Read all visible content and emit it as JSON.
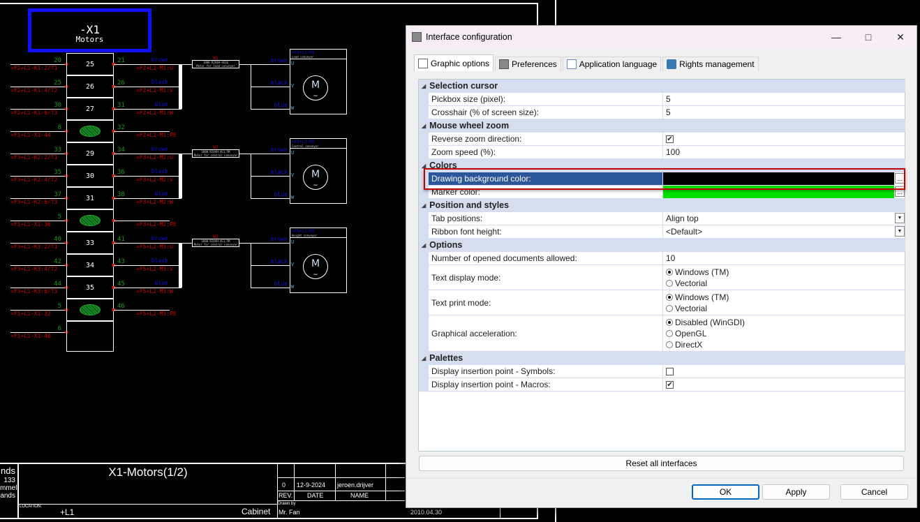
{
  "drawing": {
    "background_color": "#000000",
    "strip_title": "-X1",
    "strip_subtitle": "Motors",
    "rows": [
      {
        "left_num": "20",
        "left_ref": "=F2+L1-K1:2/T1",
        "terminal": "25",
        "right_num": "21",
        "wire": "brown",
        "right_ref": "=F2+L2-M1:U"
      },
      {
        "left_num": "25",
        "left_ref": "=F2+L1-K1:4/T2",
        "terminal": "26",
        "right_num": "26",
        "wire": "black",
        "right_ref": "=F2+L2-M1:V"
      },
      {
        "left_num": "30",
        "left_ref": "=F2+L1-K1:6/T3",
        "terminal": "27",
        "right_num": "31",
        "wire": "blue",
        "right_ref": "=F2+L2-M1:W"
      },
      {
        "left_num": "8",
        "left_ref": "=F1+L1-X1-44",
        "terminal": "PE",
        "right_num": "32",
        "wire": "",
        "right_ref": "=F2+L2-M1:PE"
      },
      {
        "left_num": "33",
        "left_ref": "=F3+L1-K2:2/T1",
        "terminal": "29",
        "right_num": "34",
        "wire": "brown",
        "right_ref": "=F3+L2-M2:U"
      },
      {
        "left_num": "35",
        "left_ref": "=F3+L1-K2:4/T2",
        "terminal": "30",
        "right_num": "36",
        "wire": "black",
        "right_ref": "=F3+L2-M2:V"
      },
      {
        "left_num": "37",
        "left_ref": "=F3+L1-K2:6/T3",
        "terminal": "31",
        "right_num": "38",
        "wire": "blue",
        "right_ref": "=F3+L2-M2:W"
      },
      {
        "left_num": "5",
        "left_ref": "=F1+L1-X1-36",
        "terminal": "PE",
        "right_num": "",
        "wire": "",
        "right_ref": "=F3+L2-M2:PE"
      },
      {
        "left_num": "40",
        "left_ref": "=F3+L1-K3:2/T1",
        "terminal": "33",
        "right_num": "41",
        "wire": "brown",
        "right_ref": "=F5+L2-M3:U"
      },
      {
        "left_num": "42",
        "left_ref": "=F3+L1-K3:4/T2",
        "terminal": "34",
        "right_num": "43",
        "wire": "black",
        "right_ref": "=F5+L2-M3:V"
      },
      {
        "left_num": "44",
        "left_ref": "=F3+L1-K3:6/T3",
        "terminal": "35",
        "right_num": "45",
        "wire": "blue",
        "right_ref": "=F5+L2-M3:W"
      },
      {
        "left_num": "5",
        "left_ref": "=F1+L1-X1-32",
        "terminal": "PE",
        "right_num": "46",
        "wire": "",
        "right_ref": "=F5+L2-M3:PE"
      },
      {
        "left_num": "6",
        "left_ref": "=F1+L1-X1-40",
        "terminal": "",
        "right_num": "",
        "wire": "",
        "right_ref": ""
      }
    ],
    "motors": [
      {
        "cable": "W1",
        "cable_type": "1000 R2V4H-4G16",
        "cable_desc": "Motor for load conveyor",
        "tag": "=F2+L2-M1",
        "desc": "Load conveyor",
        "symbol": "M",
        "phases": [
          "U",
          "V",
          "W"
        ],
        "wires": [
          "brown",
          "black",
          "blue"
        ]
      },
      {
        "cable": "W2",
        "cable_type": "1000 R2V4H-4G1.5M",
        "cable_desc": "Motor for central conveyor",
        "tag": "=F3+L2-M2",
        "desc": "Central conveyor",
        "symbol": "M",
        "phases": [
          "U",
          "V",
          "W"
        ],
        "wires": [
          "brown",
          "black",
          "blue"
        ]
      },
      {
        "cable": "W3",
        "cable_type": "1000 R2V4H-4G1.5M",
        "cable_desc": "Motor for central conveyor",
        "tag": "=F5+L2-M3",
        "desc": "Height conveyor",
        "symbol": "M",
        "phases": [
          "U",
          "V",
          "W"
        ],
        "wires": [
          "brown",
          "black",
          "blue"
        ]
      }
    ],
    "title_block": {
      "left_lines": [
        "nds",
        "133",
        "mmel",
        "ands"
      ],
      "title": "X1-Motors(1/2)",
      "location_label": "LOCATION:",
      "location": "+L1",
      "cabinet": "Cabinet",
      "rev": "0",
      "date": "12-9-2024",
      "name": "jeroen.drijver",
      "rev_header": "REV.",
      "date_header": "DATE",
      "name_header": "NAME",
      "drawn_by_label": "Drawn by",
      "drawn_by": "Mr. Fan",
      "drawing_date": "2010.04.30"
    }
  },
  "dialog": {
    "title": "Interface configuration",
    "tabs": [
      {
        "label": "Graphic options",
        "icon": "window-icon",
        "active": true
      },
      {
        "label": "Preferences",
        "icon": "settings-window-icon",
        "active": false
      },
      {
        "label": "Application language",
        "icon": "translate-icon",
        "active": false
      },
      {
        "label": "Rights management",
        "icon": "lock-icon",
        "active": false
      }
    ],
    "sections": [
      {
        "title": "Selection cursor",
        "rows": [
          {
            "label": "Pickbox size (pixel):",
            "type": "text",
            "value": "5"
          },
          {
            "label": "Crosshair (% of screen size):",
            "type": "text",
            "value": "5"
          }
        ]
      },
      {
        "title": "Mouse wheel zoom",
        "rows": [
          {
            "label": "Reverse zoom direction:",
            "type": "checkbox",
            "checked": true
          },
          {
            "label": "Zoom speed (%):",
            "type": "text",
            "value": "100"
          }
        ]
      },
      {
        "title": "Colors",
        "rows": [
          {
            "label": "Drawing background color:",
            "type": "color",
            "color": "#000000",
            "selected": true,
            "button": "..."
          },
          {
            "label": "Marker color:",
            "type": "color",
            "color": "#00e000",
            "button": "..."
          }
        ]
      },
      {
        "title": "Position and styles",
        "rows": [
          {
            "label": "Tab positions:",
            "type": "select",
            "value": "Align top"
          },
          {
            "label": "Ribbon font height:",
            "type": "select",
            "value": "<Default>"
          }
        ]
      },
      {
        "title": "Options",
        "rows": [
          {
            "label": "Number of opened documents allowed:",
            "type": "text",
            "value": "10"
          },
          {
            "label": "Text display mode:",
            "type": "radio",
            "options": [
              "Windows (TM)",
              "Vectorial"
            ],
            "selected": 0
          },
          {
            "label": "Text print mode:",
            "type": "radio",
            "options": [
              "Windows (TM)",
              "Vectorial"
            ],
            "selected": 0
          },
          {
            "label": "Graphical acceleration:",
            "type": "radio",
            "options": [
              "Disabled (WinGDI)",
              "OpenGL",
              "DirectX"
            ],
            "selected": 0
          }
        ]
      },
      {
        "title": "Palettes",
        "rows": [
          {
            "label": "Display insertion point - Symbols:",
            "type": "checkbox",
            "checked": false
          },
          {
            "label": "Display insertion point - Macros:",
            "type": "checkbox",
            "checked": true
          }
        ]
      }
    ],
    "reset_label": "Reset all interfaces",
    "ok_label": "OK",
    "apply_label": "Apply",
    "cancel_label": "Cancel",
    "highlight_color": "#c00000",
    "selection_color": "#2b579a"
  }
}
